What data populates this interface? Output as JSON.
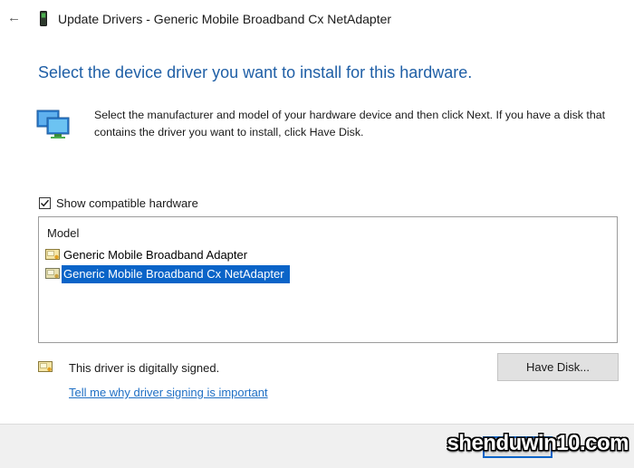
{
  "titlebar": {
    "back_glyph": "←",
    "title": "Update Drivers - Generic Mobile Broadband Cx NetAdapter"
  },
  "heading": "Select the device driver you want to install for this hardware.",
  "instructions": "Select the manufacturer and model of your hardware device and then click Next. If you have a disk that contains the driver you want to install, click Have Disk.",
  "show_compatible": {
    "label": "Show compatible hardware",
    "checked": true
  },
  "model_list": {
    "header": "Model",
    "items": [
      {
        "label": "Generic Mobile Broadband Adapter",
        "selected": false
      },
      {
        "label": "Generic Mobile Broadband Cx NetAdapter",
        "selected": true
      }
    ]
  },
  "signing": {
    "status": "This driver is digitally signed.",
    "link": "Tell me why driver signing is important"
  },
  "have_disk_label": "Have Disk...",
  "watermark": "shenduwin10.com",
  "colors": {
    "heading": "#1f5fa6",
    "selection": "#0a64c8",
    "link": "#1f6fc4",
    "button": "#e1e1e1"
  },
  "icons": {
    "back": "back-arrow-icon",
    "device": "mobile-device-icon",
    "monitors": "monitors-icon",
    "driver": "driver-icon",
    "signed": "signed-certificate-icon",
    "checkbox": "checkmark-icon"
  }
}
